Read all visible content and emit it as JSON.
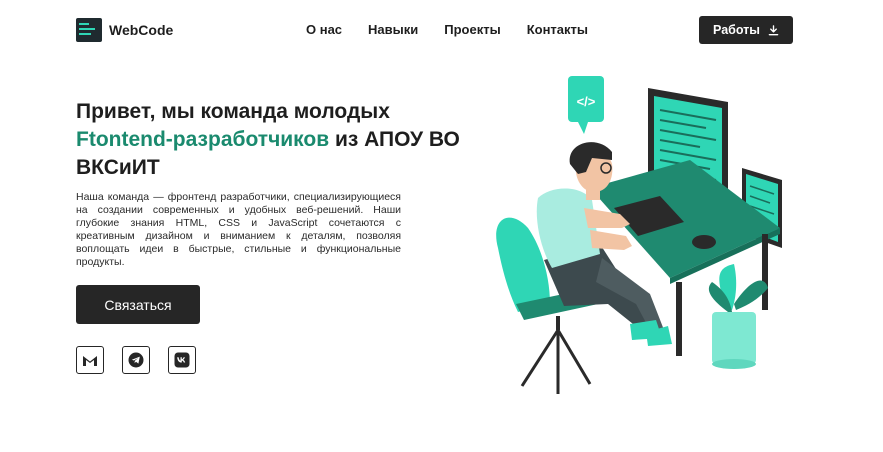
{
  "header": {
    "brand": "WebCode",
    "nav": [
      {
        "label": "О нас"
      },
      {
        "label": "Навыки"
      },
      {
        "label": "Проекты"
      },
      {
        "label": "Контакты"
      }
    ],
    "work_button": "Работы"
  },
  "hero": {
    "title_bold": "Привет,",
    "title_part1": " мы команда молодых ",
    "title_accent": "Ftontend-разработчиков",
    "title_part2": " из АПОУ ВО ВКСиИТ",
    "description": "Наша команда — фронтенд разработчики, специализирующиеся на создании современных и удобных веб-решений. Наши глубокие знания HTML, CSS и JavaScript сочетаются с креативным дизайном и вниманием к деталям, позволяя воплощать идеи в быстрые, стильные и функциональные продукты.",
    "contact_button": "Связаться"
  },
  "socials": [
    {
      "icon": "gmail-icon"
    },
    {
      "icon": "telegram-icon"
    },
    {
      "icon": "vk-icon"
    }
  ],
  "colors": {
    "accent": "#1a8a6e",
    "teal": "#2fd6b5",
    "dark": "#262626"
  }
}
